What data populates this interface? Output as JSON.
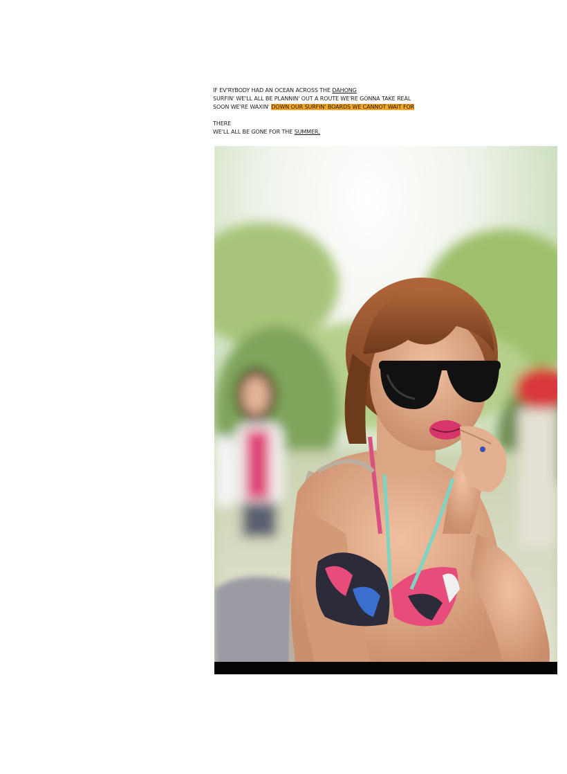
{
  "lyrics": {
    "line1_pre": "IF EV'RYBODY HAD AN OCEAN ACROSS THE ",
    "line1_link": "DAHONG",
    "line2": "SURFIN' WE'LL ALL BE PLANNIN' OUT A ROUTE WE'RE GONNA TAKE REAL",
    "line3_pre": "SOON WE'RE WAXIN' ",
    "line3_highlight": "DOWN OUR SURFIN' BOARDS WE CANNOT WAIT FOR",
    "line4": "THERE",
    "line5_pre": "WE'LL ALL BE GONE FOR THE ",
    "line5_link": "SUMMER,"
  },
  "colors": {
    "highlight": "#f6a623",
    "text": "#1a1a1a",
    "photo_bar": "#050505"
  }
}
